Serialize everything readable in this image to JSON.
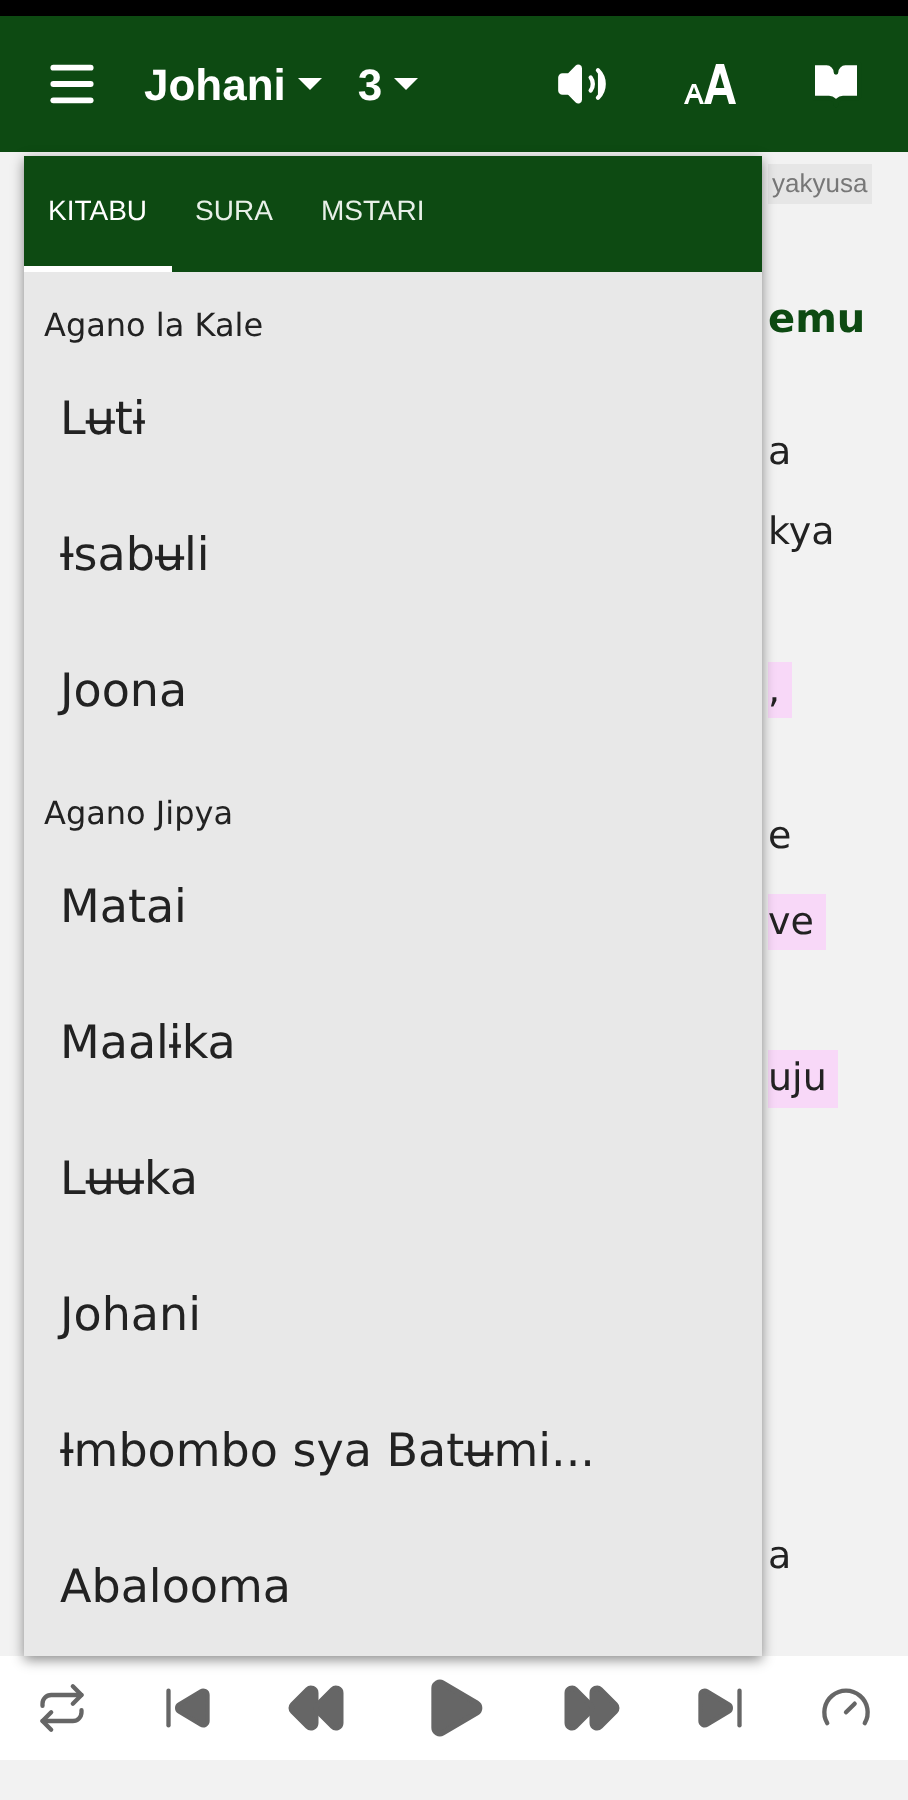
{
  "app_bar": {
    "book": "Johani",
    "chapter": "3"
  },
  "background": {
    "badge": "yakyusa",
    "heading": "emu",
    "fragments": [
      {
        "text": "a",
        "highlighted": false
      },
      {
        "text": "kya",
        "highlighted": false
      },
      {
        "text": ",",
        "highlighted": true
      },
      {
        "text": "e",
        "highlighted": false
      },
      {
        "text": "ve",
        "highlighted": true
      },
      {
        "text": "uju",
        "highlighted": true
      },
      {
        "text": "a",
        "highlighted": false
      }
    ]
  },
  "picker": {
    "tabs": [
      {
        "label": "KITABU",
        "selected": true
      },
      {
        "label": "SURA",
        "selected": false
      },
      {
        "label": "MSTARI",
        "selected": false
      }
    ],
    "sections": [
      {
        "title": "Agano la Kale",
        "books": [
          "Lʉtɨ",
          "Ɨsabʉli",
          "Joona"
        ]
      },
      {
        "title": "Agano Jipya",
        "books": [
          "Matai",
          "Maalɨka",
          "Lʉʉka",
          "Johani",
          "Ɨmbombo sya Batʉmi...",
          "Abalooma"
        ]
      }
    ]
  }
}
